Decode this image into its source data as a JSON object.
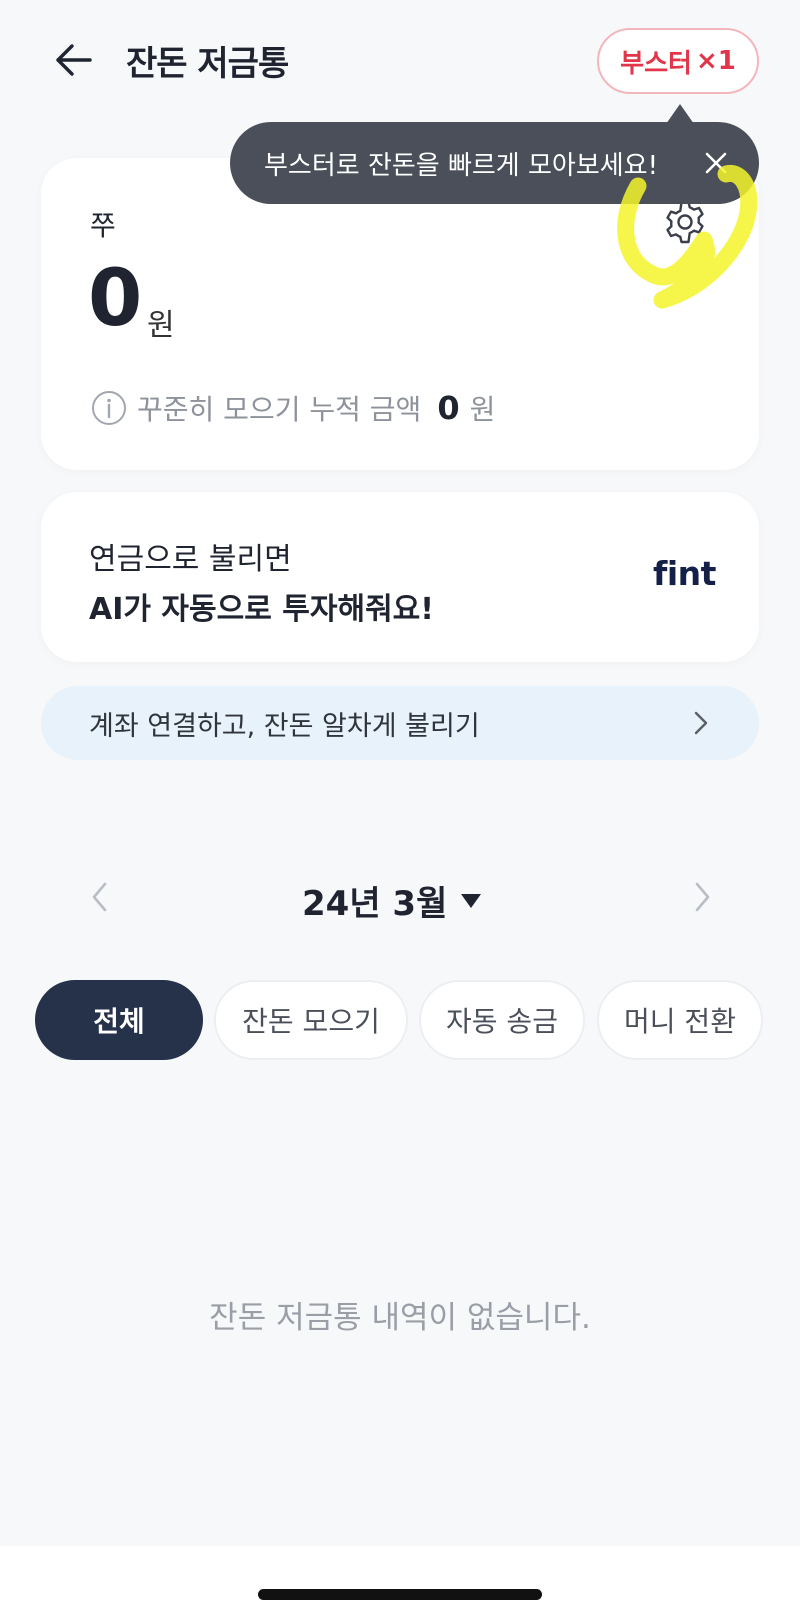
{
  "header": {
    "title": "잔돈 저금통",
    "booster_label": "부스터",
    "booster_count": "×1"
  },
  "tooltip": {
    "text": "부스터로 잔돈을 빠르게 모아보세요!"
  },
  "balance_card": {
    "owner_name": "쭈",
    "amount": "0",
    "amount_unit": "원",
    "accumulated_label": "꾸준히 모으기 누적 금액",
    "accumulated_amount": "0",
    "accumulated_unit": "원"
  },
  "pension_card": {
    "line1": "연금으로 불리면",
    "line2": "AI가 자동으로 투자해줘요!",
    "logo_text": "fint"
  },
  "link_banner": {
    "text": "계좌 연결하고, 잔돈 알차게 불리기"
  },
  "month_nav": {
    "label": "24년 3월"
  },
  "filters": {
    "items": [
      {
        "label": "전체",
        "active": true
      },
      {
        "label": "잔돈 모으기",
        "active": false
      },
      {
        "label": "자동 송금",
        "active": false
      },
      {
        "label": "머니 전환",
        "active": false
      }
    ]
  },
  "empty_state": {
    "message": "잔돈 저금통 내역이 없습니다."
  },
  "colors": {
    "background": "#f7f8fa",
    "booster_accent": "#e2354a",
    "tooltip_bg": "#4a4f59",
    "active_chip": "#26324a",
    "banner_bg": "#e7f2fa",
    "highlight_annotation": "#f5f52a"
  },
  "icons": {
    "back": "arrow-left-icon",
    "close": "close-icon",
    "settings": "gear-icon",
    "info": "info-icon",
    "chevron_right": "chevron-right-icon",
    "chevron_left": "chevron-left-icon",
    "caret_down": "caret-down-icon"
  }
}
